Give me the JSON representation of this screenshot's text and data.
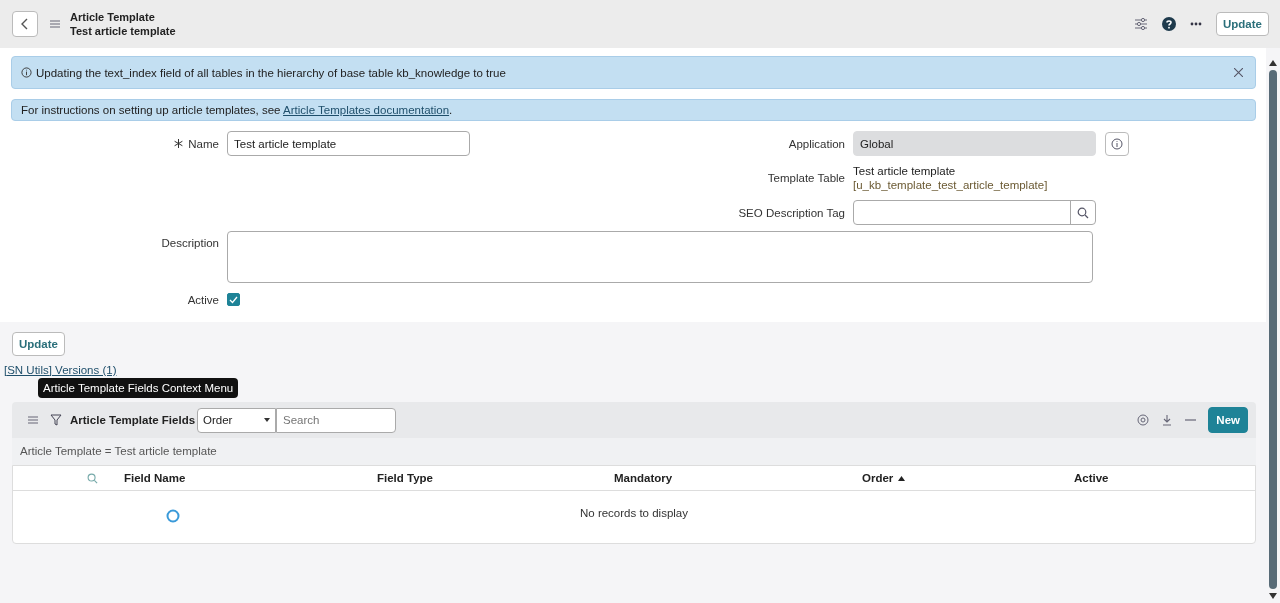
{
  "header": {
    "title": "Article Template",
    "subtitle": "Test article template",
    "update_button": "Update"
  },
  "info_messages": [
    {
      "kind": "info",
      "text": "Updating the text_index field of all tables in the hierarchy of base table kb_knowledge to true",
      "closable": true
    },
    {
      "kind": "plain",
      "text": "For instructions on setting up article templates, see ",
      "link": "Article Templates documentation",
      "after": "."
    }
  ],
  "form": {
    "name": {
      "label": "Name",
      "required": true,
      "value": "Test article template"
    },
    "application": {
      "label": "Application",
      "value": "Global"
    },
    "template_table": {
      "label": "Template Table",
      "value": "Test article template",
      "value_2": "[u_kb_template_test_article_template]"
    },
    "seo_description_tag": {
      "label": "SEO Description Tag"
    },
    "description": {
      "label": "Description"
    },
    "active": {
      "label": "Active",
      "checked": true
    }
  },
  "update_button": "Update",
  "versions_link": "[SN Utils] Versions (1)",
  "related_list": {
    "tooltip": "Article Template Fields Context Menu",
    "title": "Article Template Fields",
    "sort_field": "Order",
    "search_placeholder": "Search",
    "new_button": "New",
    "breadcrumb": "Article Template = Test article template",
    "columns": [
      {
        "label": "Field Name",
        "sorted": false
      },
      {
        "label": "Field Type",
        "sorted": false
      },
      {
        "label": "Mandatory",
        "sorted": false
      },
      {
        "label": "Order",
        "sorted": true
      },
      {
        "label": "Active",
        "sorted": false
      }
    ],
    "empty_text": "No records to display",
    "loading": true
  }
}
